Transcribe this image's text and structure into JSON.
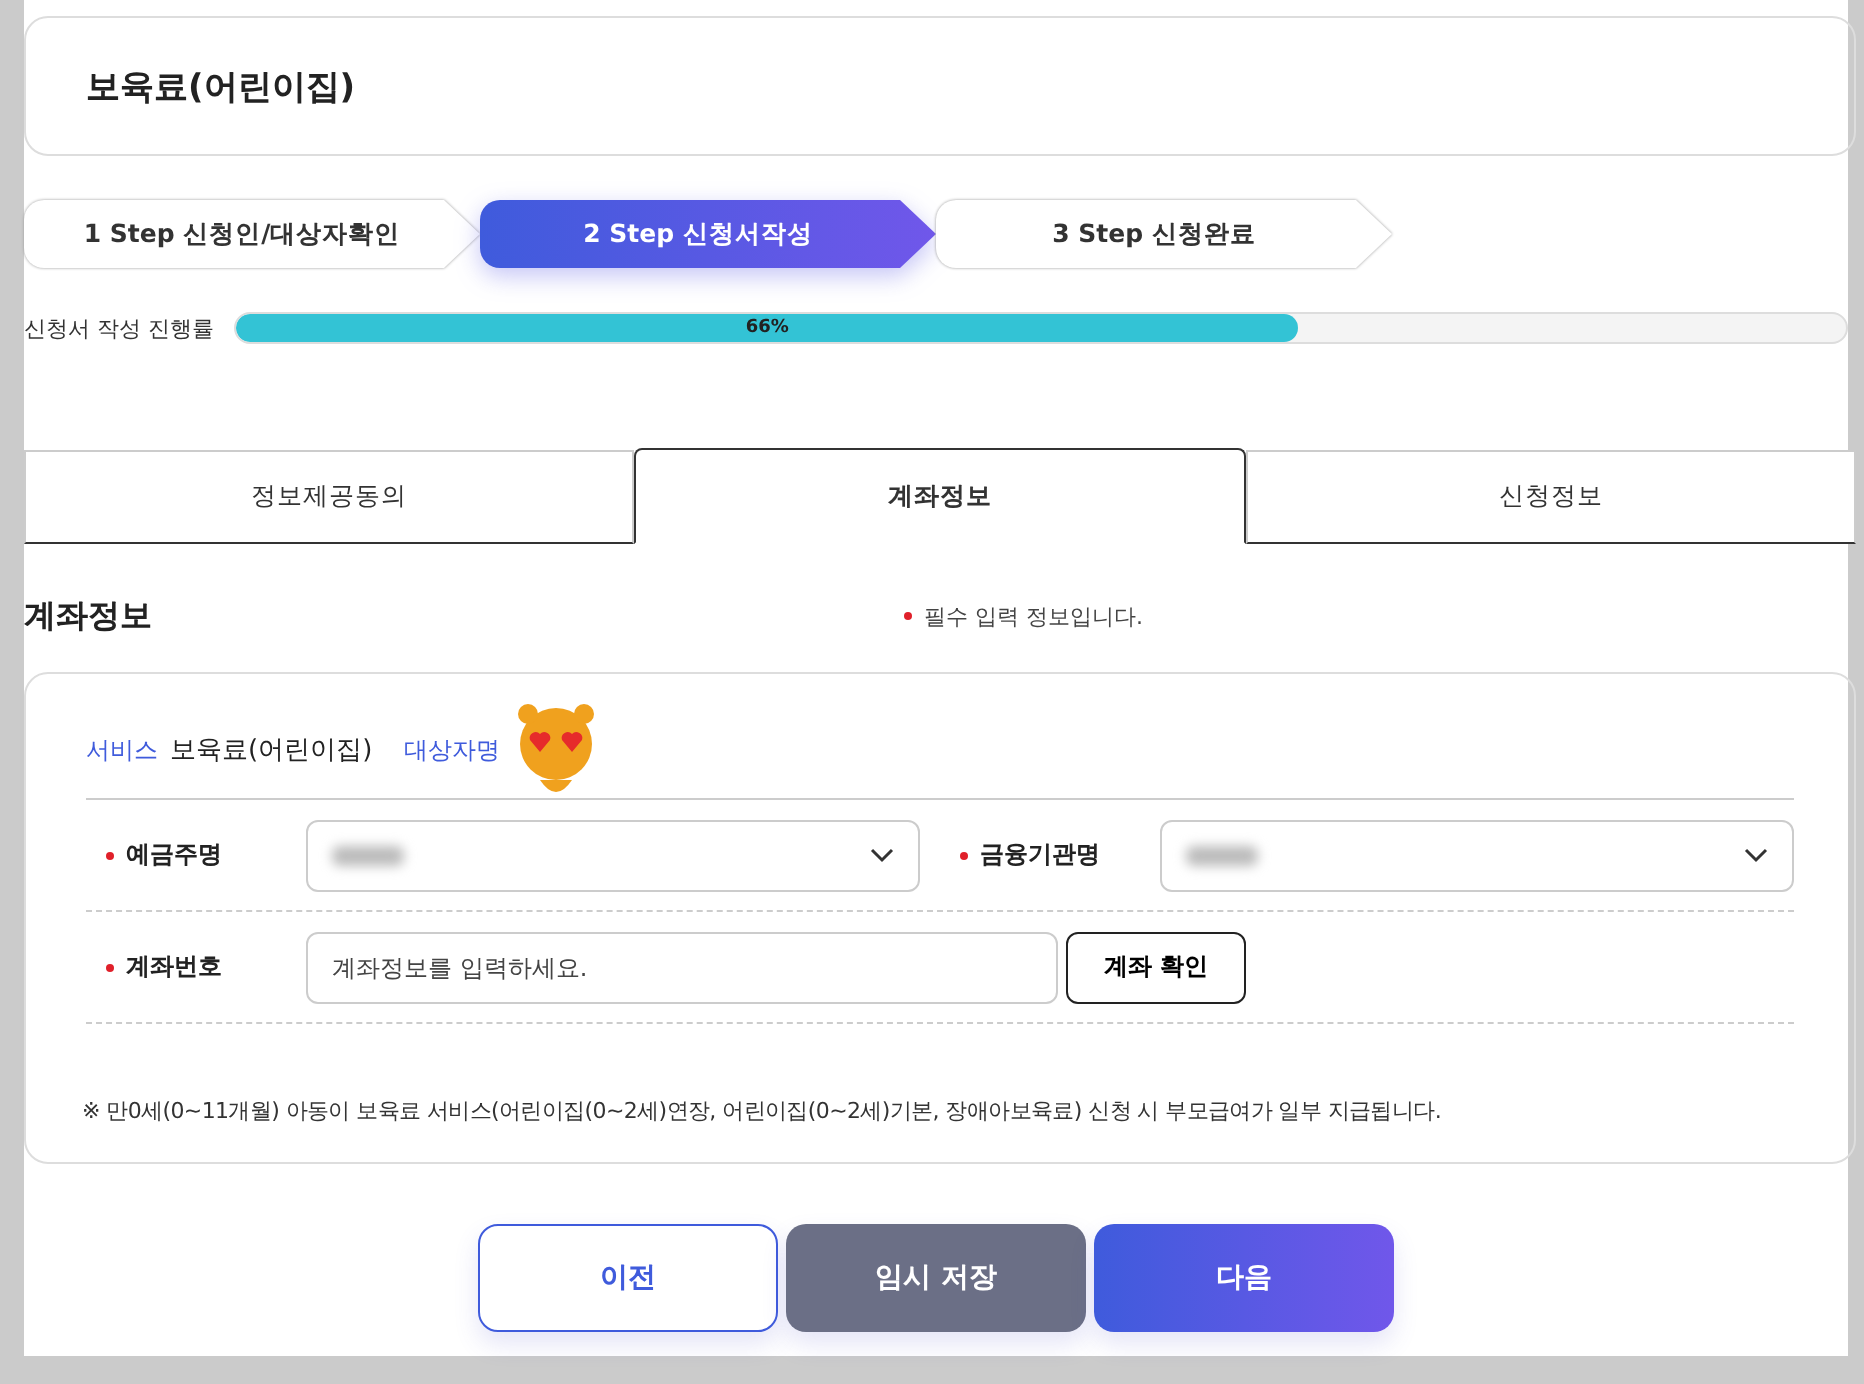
{
  "page_title": "보육료(어린이집)",
  "steps": [
    {
      "label": "1 Step 신청인/대상자확인",
      "selected": false
    },
    {
      "label": "2 Step 신청서작성",
      "selected": true
    },
    {
      "label": "3 Step 신청완료",
      "selected": false
    }
  ],
  "progress": {
    "label": "신청서 작성 진행률",
    "level": 0.66,
    "reading": "66%"
  },
  "tabs": [
    {
      "label": "정보제공동의",
      "selected": false
    },
    {
      "label": "계좌정보",
      "selected": true
    },
    {
      "label": "신청정보",
      "selected": false
    }
  ],
  "section": {
    "title": "계좌정보",
    "required_note": "필수 입력 정보입니다."
  },
  "service": {
    "label": "서비스",
    "value": "보육료(어린이집)",
    "target_label": "대상자명"
  },
  "fields": [
    {
      "kind": "select",
      "label": "예금주명",
      "required": true,
      "redacted": true
    },
    {
      "kind": "select",
      "label": "금융기관명",
      "required": true,
      "redacted": true
    },
    {
      "kind": "input",
      "label": "계좌번호",
      "required": true,
      "placeholder": "계좌정보를 입력하세요.",
      "button": "계좌 확인"
    }
  ],
  "notice": "※ 만0세(0~11개월) 아동이 보육료 서비스(어린이집(0~2세)연장, 어린이집(0~2세)기본, 장애아보육료) 신청 시 부모급여가 일부 지급됩니다.",
  "buttons": [
    {
      "label": "이전",
      "kind": "outline"
    },
    {
      "label": "임시 저장",
      "kind": "secondary"
    },
    {
      "label": "다음",
      "kind": "primary"
    }
  ]
}
